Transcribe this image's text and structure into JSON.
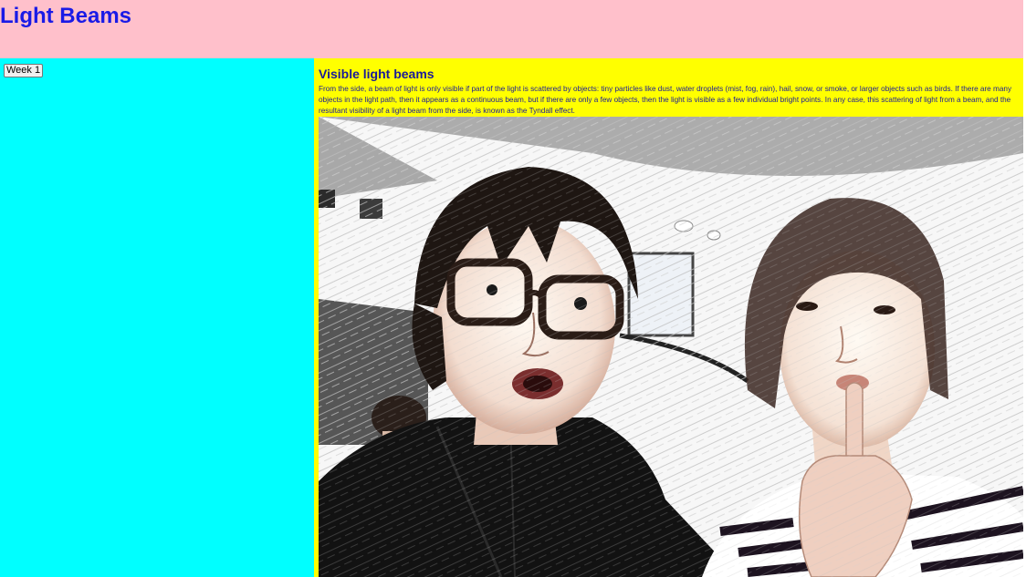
{
  "header": {
    "title": "Light Beams"
  },
  "sidebar": {
    "week_button_label": "Week 1"
  },
  "article": {
    "heading": "Visible light beams",
    "body": "From the side, a beam of light is only visible if part of the light is scattered by objects: tiny particles like dust, water droplets (mist, fog, rain), hail, snow, or smoke, or larger objects such as birds. If there are many objects in the light path, then it appears as a continuous beam, but if there are only a few objects, then the light is visible as a few individual bright points. In any case, this scattering of light from a beam, and the resultant visibility of a light beam from the side, is known as the Tyndall effect."
  },
  "colors": {
    "header_bg": "#ffc0cb",
    "sidebar_bg": "#00ffff",
    "article_bg": "#ffff00",
    "title_text": "#1a1ae6",
    "body_text": "#1a1a99"
  }
}
